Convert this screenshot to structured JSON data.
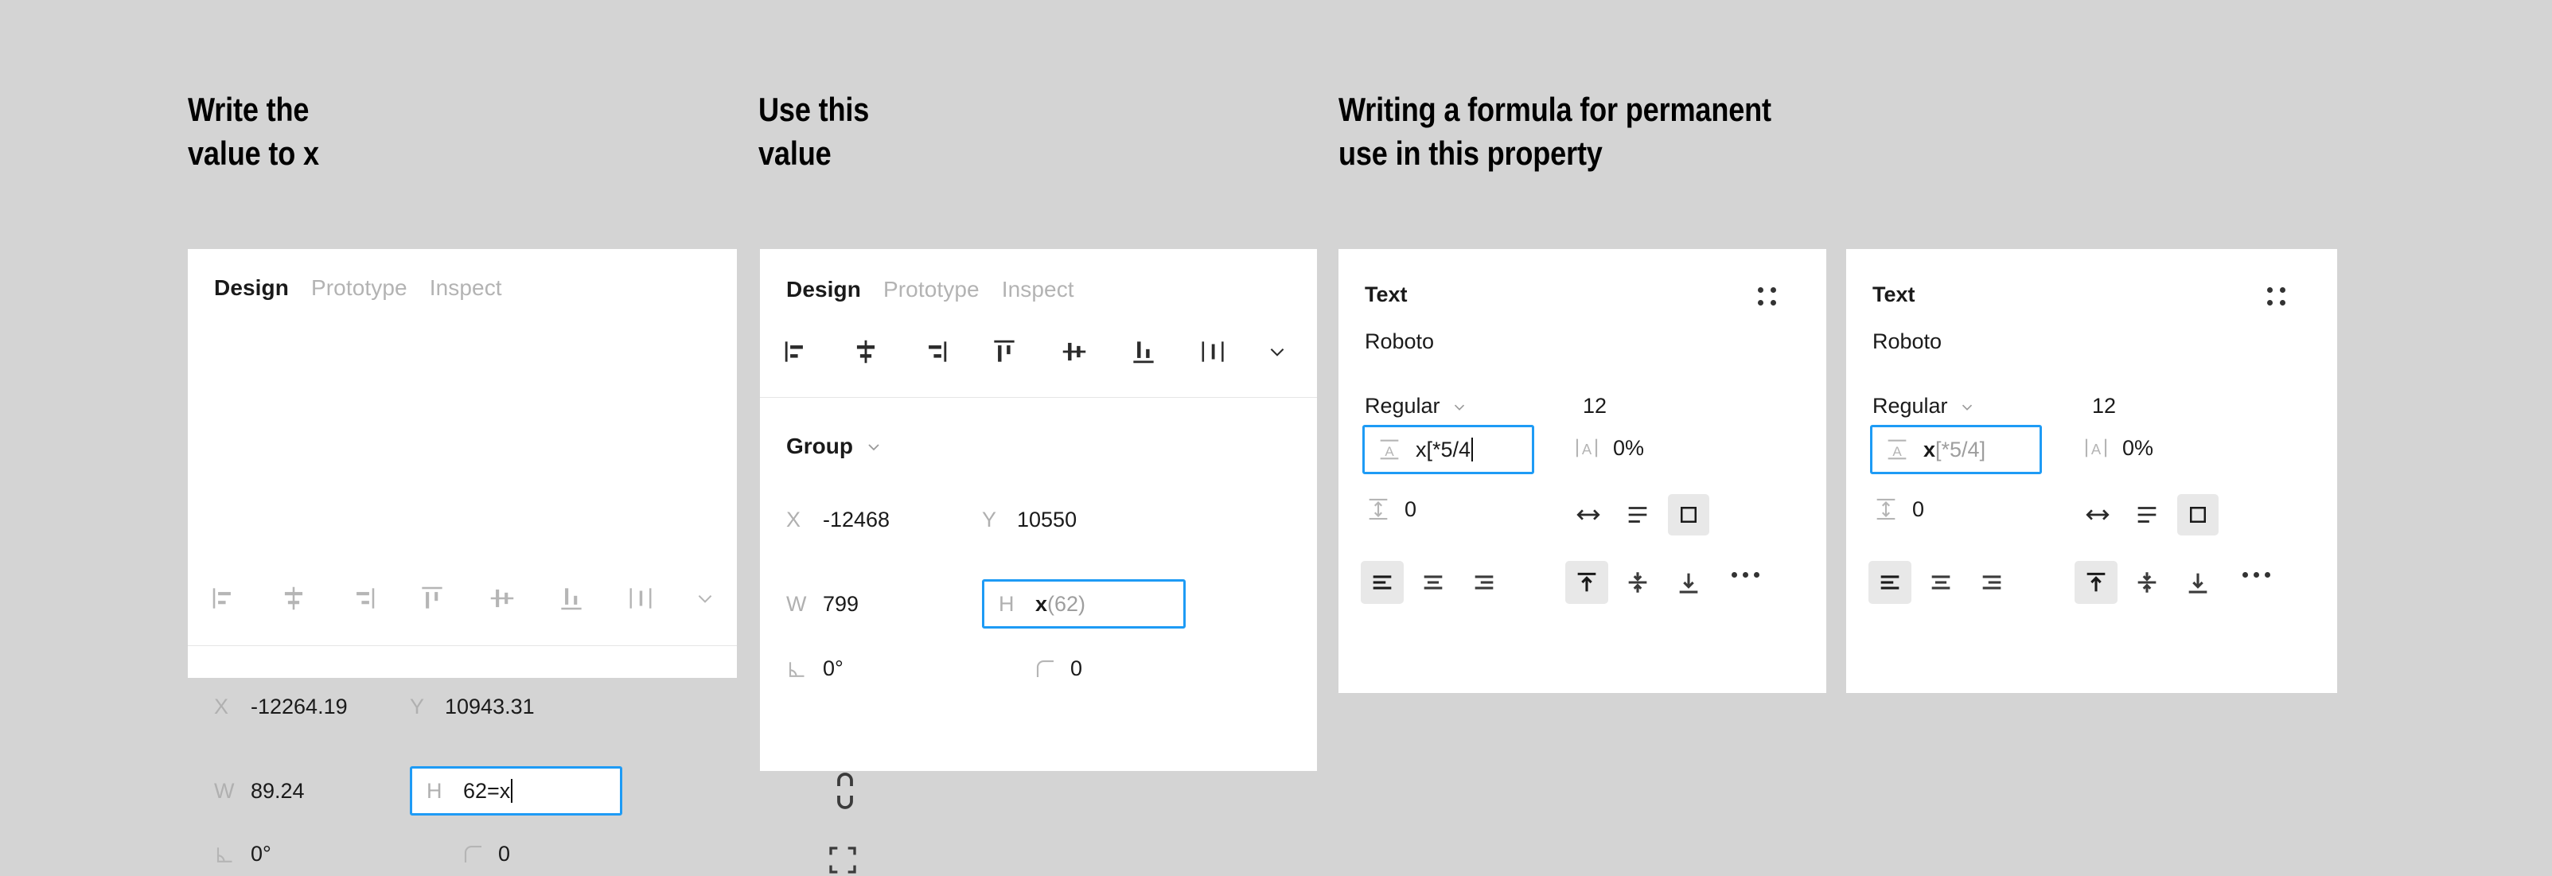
{
  "headings": {
    "h1": "Write the\nvalue to x",
    "h2": "Use this\nvalue",
    "h3": "Writing a formula for permanent\nuse in this property"
  },
  "colors": {
    "canvas": "#d4d4d4",
    "panel": "#ffffff",
    "accent_focus_border": "#1e9bf5",
    "label_gray": "#b0b0b0",
    "value_dark": "#1a1a1a",
    "value_dim": "#9e9e9e",
    "selected_button_bg": "#e8e8e8"
  },
  "panel1": {
    "tabs": [
      {
        "label": "Design",
        "active": true
      },
      {
        "label": "Prototype",
        "active": false
      },
      {
        "label": "Inspect",
        "active": false
      }
    ],
    "align_icons": [
      "align-left-icon",
      "align-horizontal-center-icon",
      "align-right-icon",
      "align-top-icon",
      "align-vertical-center-icon",
      "align-bottom-icon",
      "distribute-icon",
      "chevron-down-icon"
    ],
    "fields": {
      "x": {
        "label": "X",
        "value": "-12264.19"
      },
      "y": {
        "label": "Y",
        "value": "10943.31"
      },
      "w": {
        "label": "W",
        "value": "89.24"
      },
      "h": {
        "label": "H",
        "value": "62=x",
        "focused": true,
        "caret": true
      },
      "rotation": {
        "label": "rotation-icon",
        "value": "0°"
      },
      "corner_radius": {
        "label": "corner-radius-icon",
        "value": "0"
      }
    },
    "side_icons": [
      "constrain-proportions-broken-icon",
      "resize-to-fit-icon"
    ]
  },
  "panel2": {
    "tabs": [
      {
        "label": "Design",
        "active": true
      },
      {
        "label": "Prototype",
        "active": false
      },
      {
        "label": "Inspect",
        "active": false
      }
    ],
    "section_title": "Group",
    "fields": {
      "x": {
        "label": "X",
        "value": "-12468"
      },
      "y": {
        "label": "Y",
        "value": "10550"
      },
      "w": {
        "label": "W",
        "value": "799"
      },
      "h": {
        "label": "H",
        "value_main": "x",
        "value_dim": "(62)",
        "focused": true
      },
      "rotation": {
        "label": "rotation-icon",
        "value": "0°"
      },
      "corner_radius": {
        "label": "corner-radius-icon",
        "value": "0"
      }
    },
    "side_icons": [
      "constrain-proportions-broken-icon",
      "resize-to-fit-icon"
    ]
  },
  "panel3": {
    "title": "Text",
    "font_family": "Roboto",
    "font_weight": "Regular",
    "font_size": "12",
    "line_height": {
      "value": "x[*5/4",
      "focused": true,
      "caret": true
    },
    "letter_spacing": {
      "label": "letter-spacing-icon",
      "value": "0%"
    },
    "paragraph_spacing": {
      "label": "paragraph-spacing-icon",
      "value": "0"
    },
    "resize_modes": [
      "auto-width-icon",
      "auto-height-icon",
      "fixed-size-icon"
    ],
    "resize_selected_index": 2,
    "h_align": [
      "align-text-left-icon",
      "align-text-center-icon",
      "align-text-right-icon"
    ],
    "h_align_selected_index": 0,
    "v_align": [
      "align-text-top-icon",
      "align-text-middle-icon",
      "align-text-bottom-icon"
    ],
    "v_align_selected_index": 0,
    "more_label": "more-options-icon",
    "grid_label": "apply-styles-icon"
  },
  "panel4": {
    "title": "Text",
    "font_family": "Roboto",
    "font_weight": "Regular",
    "font_size": "12",
    "line_height": {
      "value_main": "x",
      "value_dim": "[*5/4]",
      "focused": true
    },
    "letter_spacing": {
      "label": "letter-spacing-icon",
      "value": "0%"
    },
    "paragraph_spacing": {
      "label": "paragraph-spacing-icon",
      "value": "0"
    },
    "resize_modes": [
      "auto-width-icon",
      "auto-height-icon",
      "fixed-size-icon"
    ],
    "resize_selected_index": 2,
    "h_align": [
      "align-text-left-icon",
      "align-text-center-icon",
      "align-text-right-icon"
    ],
    "h_align_selected_index": 0,
    "v_align": [
      "align-text-top-icon",
      "align-text-middle-icon",
      "align-text-bottom-icon"
    ],
    "v_align_selected_index": 0,
    "more_label": "more-options-icon",
    "grid_label": "apply-styles-icon"
  }
}
